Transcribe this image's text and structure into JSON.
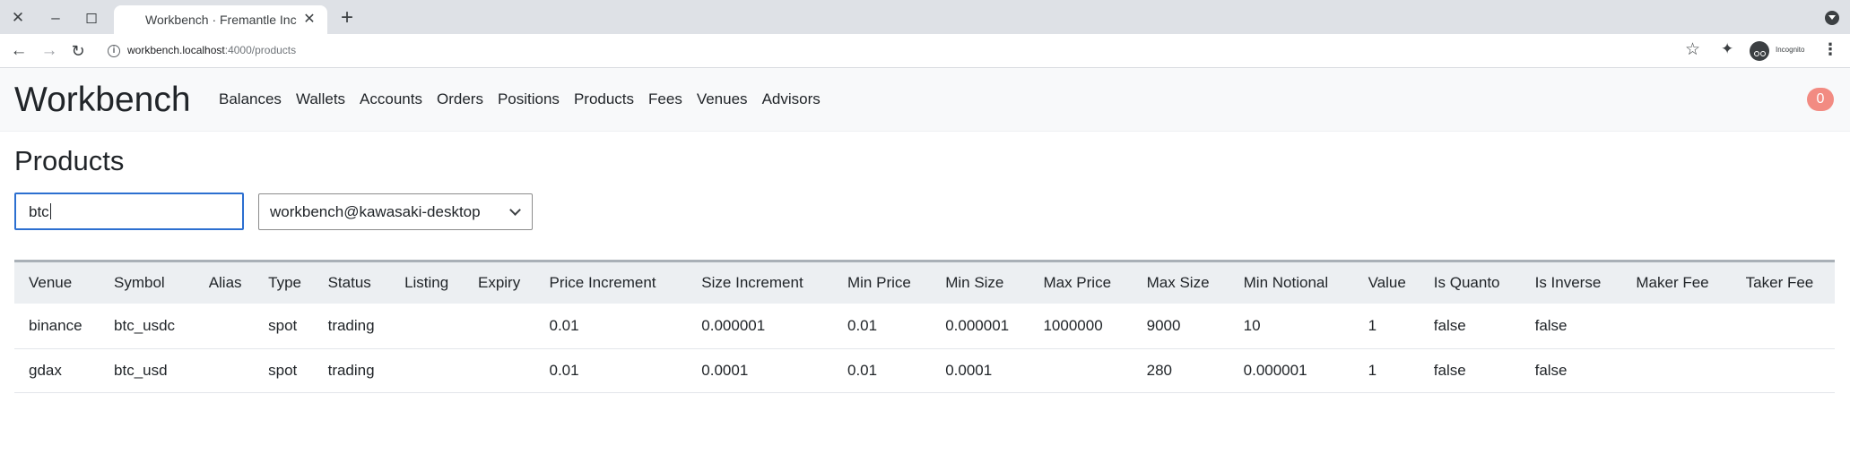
{
  "browser": {
    "tab_title": "Workbench · Fremantle Inc",
    "url_host": "workbench.localhost",
    "url_path": ":4000/products",
    "incognito_label": "Incognito"
  },
  "nav": {
    "brand": "Workbench",
    "links": [
      "Balances",
      "Wallets",
      "Accounts",
      "Orders",
      "Positions",
      "Products",
      "Fees",
      "Venues",
      "Advisors"
    ],
    "notification_count": "0"
  },
  "page": {
    "title": "Products",
    "search_value": "btc",
    "node_select_value": "workbench@kawasaki-desktop"
  },
  "table": {
    "columns": [
      "Venue",
      "Symbol",
      "Alias",
      "Type",
      "Status",
      "Listing",
      "Expiry",
      "Price Increment",
      "Size Increment",
      "Min Price",
      "Min Size",
      "Max Price",
      "Max Size",
      "Min Notional",
      "Value",
      "Is Quanto",
      "Is Inverse",
      "Maker Fee",
      "Taker Fee"
    ],
    "rows": [
      [
        "binance",
        "btc_usdc",
        "",
        "spot",
        "trading",
        "",
        "",
        "0.01",
        "0.000001",
        "0.01",
        "0.000001",
        "1000000",
        "9000",
        "10",
        "1",
        "false",
        "false",
        "",
        ""
      ],
      [
        "gdax",
        "btc_usd",
        "",
        "spot",
        "trading",
        "",
        "",
        "0.01",
        "0.0001",
        "0.01",
        "0.0001",
        "",
        "280",
        "0.000001",
        "1",
        "false",
        "false",
        "",
        ""
      ]
    ]
  },
  "colors": {
    "badge": "#f28b82",
    "input_focus_border": "#2c6fd0",
    "table_header_bg": "#eceff2"
  }
}
